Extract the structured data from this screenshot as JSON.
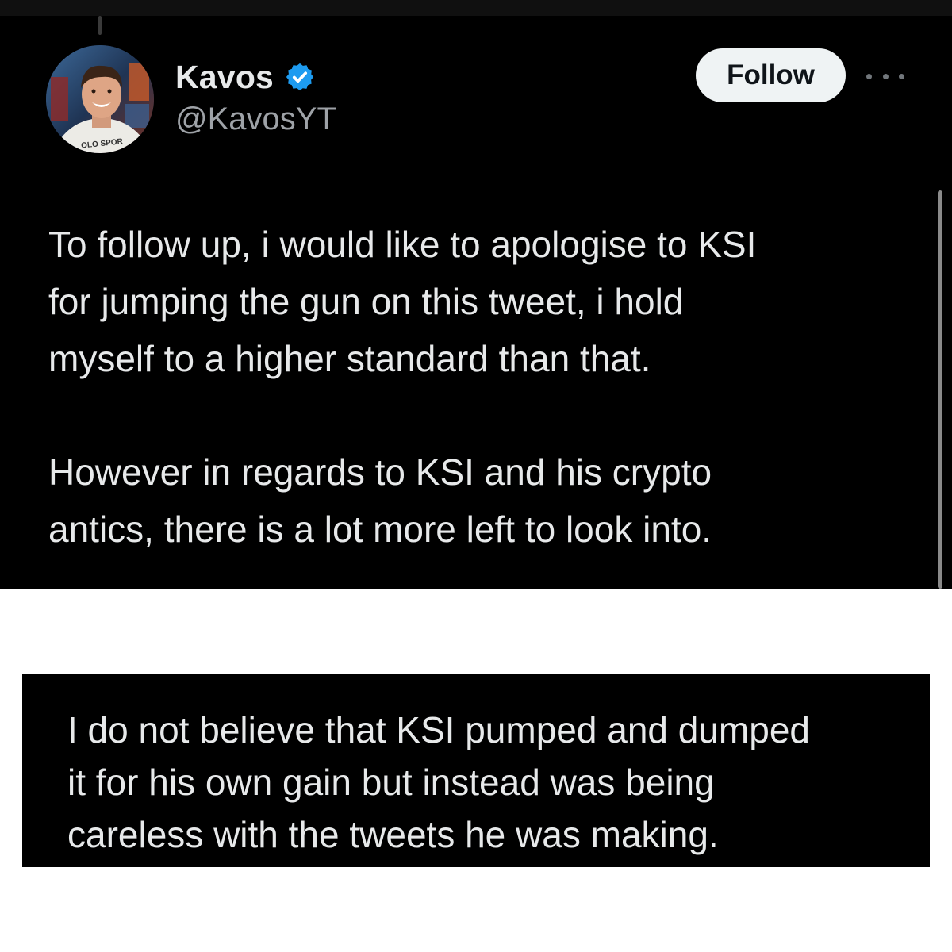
{
  "tweet": {
    "display_name": "Kavos",
    "handle": "@KavosYT",
    "verified": true,
    "follow_label": "Follow",
    "avatar_shirt_text": "OLO SPOR",
    "body_lines": [
      "To follow up, i would like to apologise to KSI",
      "for jumping the gun on this tweet, i hold",
      "myself to a higher standard than that.",
      "However in regards to KSI and his crypto",
      "antics, there is  a lot more left to look into."
    ]
  },
  "excerpt": {
    "lines": [
      "I do not believe that KSI pumped and dumped",
      "it for his own gain but instead was being",
      "careless with the tweets he was making."
    ]
  },
  "colors": {
    "background": "#000000",
    "text": "#e7e9ea",
    "muted": "#9ea2a7",
    "verified_badge": "#1d9bf0",
    "follow_button_bg": "#eff3f4"
  },
  "icons": [
    "verified-badge-icon",
    "more-options-icon"
  ]
}
